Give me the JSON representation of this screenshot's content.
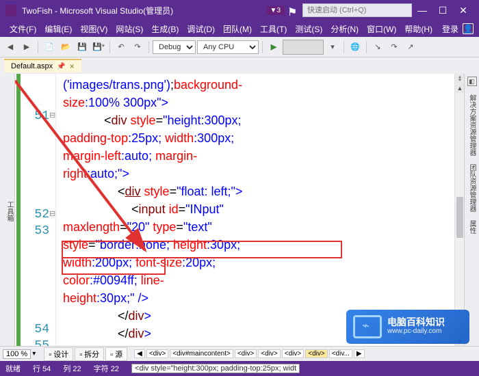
{
  "title": "TwoFish - Microsoft Visual Studio(管理员)",
  "notification_count": "3",
  "quick_launch_placeholder": "快速启动 (Ctrl+Q)",
  "login_label": "登录",
  "menu": [
    "文件(F)",
    "编辑(E)",
    "视图(V)",
    "网站(S)",
    "生成(B)",
    "调试(D)",
    "团队(M)",
    "工具(T)",
    "测试(S)",
    "分析(N)",
    "窗口(W)",
    "帮助(H)"
  ],
  "toolbar": {
    "configuration": "Debug",
    "platform": "Any CPU",
    "run_label": ""
  },
  "tab": {
    "name": "Default.aspx",
    "pinned": true
  },
  "left_tool_label": "工具箱",
  "right_labels": [
    "解决方案资源管理器",
    "团队资源管理器",
    "属性"
  ],
  "zoom": "100 %",
  "bottom_tabs": {
    "design": "设计",
    "split": "拆分",
    "source": "源"
  },
  "breadcrumb": [
    "<div>",
    "<div#maincontent>",
    "<div>",
    "<div>",
    "<div>",
    "<div>",
    "<div..."
  ],
  "status": {
    "ready": "就绪",
    "line_lbl": "行",
    "line": "54",
    "col_lbl": "列",
    "col": "22",
    "char_lbl": "字符",
    "char": "22",
    "hint": "<div style=\"height:300px; padding-top:25px; widt"
  },
  "gutter_lines": {
    "l51": "51",
    "l52": "52",
    "l53": "53",
    "l54": "54",
    "l55": "55"
  },
  "code_lines": {
    "c1a": "('images/trans.png')",
    "c1b": ";",
    "c1c": "background-",
    "c2a": "size",
    "c2b": ":100% 300px\"",
    "c2c": ">",
    "c3a": "            <",
    "c3b": "div",
    "c3c": " style",
    "c3d": "=",
    "c3e": "\"height",
    "c3f": ":300px;",
    "c4a": "padding-top",
    "c4b": ":25px; ",
    "c4c": "width",
    "c4d": ":300px;",
    "c5a": "margin-left",
    "c5b": ":auto; ",
    "c5c": "margin-",
    "c6a": "right",
    "c6b": ":auto;\"",
    "c6c": ">",
    "c7a": "                <",
    "c7b": "div",
    "c7c": " style",
    "c7d": "=",
    "c7e": "\"float",
    "c7f": ": left;\"",
    "c7g": ">",
    "c8a": "                    <",
    "c8b": "input",
    "c8c": " id",
    "c8d": "=",
    "c8e": "\"INput\"",
    "c9a": "maxlength",
    "c9b": "=",
    "c9c": "\"20\"",
    "c9d": " type",
    "c9e": "=",
    "c9f": "\"text\"",
    "c10a": "style",
    "c10b": "=",
    "c10c": "\"border",
    "c10d": ":none; ",
    "c10e": "height",
    "c10f": ":30px;",
    "c11a": "width",
    "c11b": ":200px; ",
    "c11c": "font-size",
    "c11d": ":20px;",
    "c12a": "color",
    "c12b": ":#0094ff; ",
    "c12c": "line-",
    "c13a": "height",
    "c13b": ":30px;\"",
    "c13c": " />",
    "c14a": "                </",
    "c14b": "div",
    "c14c": ">",
    "c15a": "                </",
    "c15b": "div",
    "c15c": ">"
  },
  "watermark": {
    "brand": "电脑百科知识",
    "url": "www.pc-daily.com"
  }
}
